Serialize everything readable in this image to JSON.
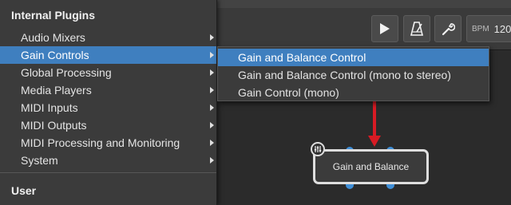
{
  "menu": {
    "heading_internal": "Internal Plugins",
    "heading_user": "User",
    "items": [
      {
        "label": "Audio Mixers"
      },
      {
        "label": "Gain Controls"
      },
      {
        "label": "Global Processing"
      },
      {
        "label": "Media Players"
      },
      {
        "label": "MIDI Inputs"
      },
      {
        "label": "MIDI Outputs"
      },
      {
        "label": "MIDI Processing and Monitoring"
      },
      {
        "label": "System"
      }
    ]
  },
  "submenu": {
    "items": [
      {
        "label": "Gain and Balance Control"
      },
      {
        "label": "Gain and Balance Control (mono to stereo)"
      },
      {
        "label": "Gain Control (mono)"
      }
    ]
  },
  "toolbar": {
    "bpm_label": "BPM",
    "bpm_value": "120",
    "icons": [
      "play-icon",
      "metronome-icon",
      "wrench-icon"
    ]
  },
  "node": {
    "label": "Gain and Balance"
  },
  "colors": {
    "highlight": "#3f7fbf",
    "pin": "#3f8fd8",
    "arrow": "#d81b24"
  }
}
